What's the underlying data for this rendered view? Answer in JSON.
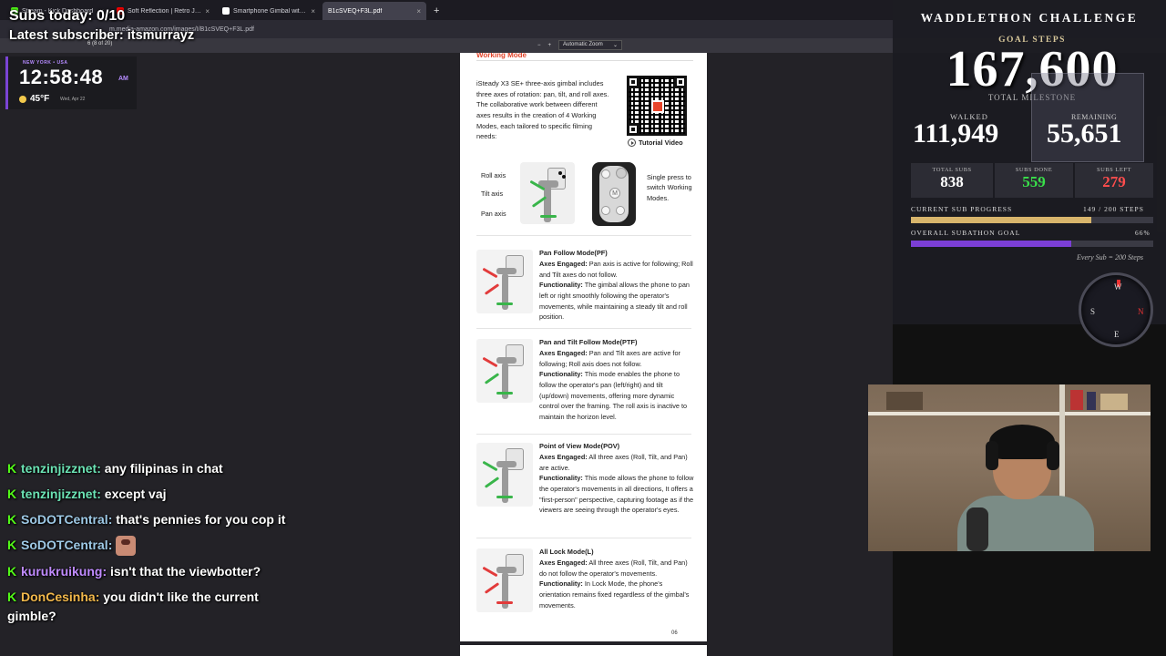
{
  "browser": {
    "tabs": [
      {
        "title": "Stream - Kick Dashboard",
        "color": "#53fc18"
      },
      {
        "title": "Soft Reflection | Retro Jazz - YouTube",
        "color": "#ff0000"
      },
      {
        "title": "Smartphone Gimbal with Phone",
        "color": "#ffffff"
      },
      {
        "title": "B1cSVEQ+F3L.pdf",
        "color": "#cccccc"
      }
    ],
    "active_tab_index": 3,
    "new_tab": "+",
    "close": "×",
    "url": "m.media-amazon.com/images/I/B1cSVEQ+F3L.pdf",
    "page_indicator": "6  (8 of 20)",
    "zoom_minus": "−",
    "zoom_plus": "+",
    "zoom_label": "Automatic Zoom",
    "zoom_arrow": "⌄"
  },
  "overlay": {
    "subs_today": "Subs today: 0/10",
    "latest_subscriber": "Latest subscriber: itsmurrayz",
    "clock_location": "NEW YORK • USA",
    "clock_time": "12:58:48",
    "clock_ampm": "AM",
    "temperature": "45°F",
    "date": "Wed, Apr 22"
  },
  "chat": [
    {
      "user": "tenzinjizznet",
      "color": "#6be3b4",
      "text": "any filipinas in chat"
    },
    {
      "user": "tenzinjizznet",
      "color": "#6be3b4",
      "text": "except vaj"
    },
    {
      "user": "SoDOTCentral",
      "color": "#9ec9e6",
      "text": "that's pennies for you cop it"
    },
    {
      "user": "SoDOTCentral",
      "color": "#9ec9e6",
      "text": "",
      "emote": "face-emote"
    },
    {
      "user": "kurukruikung",
      "color": "#c08bff",
      "text": "isn't that the viewbotter?"
    },
    {
      "user": "DonCesinha",
      "color": "#f2b84b",
      "text": "you didn't like the current gimble?"
    }
  ],
  "chat_badge": "K",
  "chat_sep": ":",
  "pdf": {
    "section_title": "Working Mode",
    "intro": "iSteady X3 SE+ three-axis gimbal includes three axes of rotation: pan, tilt, and roll axes. The collaborative work between different axes results in the creation of 4 Working Modes, each tailored to specific filming needs:",
    "tutorial": "Tutorial Video",
    "axis_labels": [
      "Roll axis",
      "Tilt axis",
      "Pan axis"
    ],
    "remote_letter": "M",
    "single_press": "Single press to switch Working Modes.",
    "axes_label": "Axes Engaged:",
    "func_label": "Functionality:",
    "modes": [
      {
        "name": "Pan Follow Mode(PF)",
        "axes": "Pan axis is active for following; Roll and Tilt axes do not follow.",
        "func": "The gimbal allows the phone to pan left or right smoothly following the operator's movements, while maintaining a steady tilt and roll position."
      },
      {
        "name": "Pan and Tilt Follow Mode(PTF)",
        "axes": "Pan and Tilt axes are active for following; Roll axis does not follow.",
        "func": "This mode enables the phone to follow the operator's pan (left/right) and tilt (up/down) movements, offering more dynamic control over the framing. The roll axis is inactive to maintain the horizon level."
      },
      {
        "name": "Point of View Mode(POV)",
        "axes": "All three axes (Roll, Tilt, and Pan) are active.",
        "func": "This mode allows the phone to follow the operator's movements in all directions, It offers a \"first-person\" perspective, capturing footage as if the viewers are seeing through the operator's eyes."
      },
      {
        "name": "All Lock Mode(L)",
        "axes": "All three axes (Roll, Tilt, and Pan) do not follow the operator's movements.",
        "func": "In Lock Mode, the phone's orientation remains fixed regardless of the gimbal's movements."
      }
    ],
    "page_number": "06"
  },
  "subathon": {
    "title": "WADDLETHON CHALLENGE",
    "goal_steps_label": "GOAL STEPS",
    "goal_steps": "167,600",
    "total_milestone": "TOTAL MILESTONE",
    "walked_label": "WALKED",
    "walked": "111,949",
    "remaining_label": "REMAINING",
    "remaining": "55,651",
    "total_subs_label": "TOTAL SUBS",
    "total_subs": "838",
    "subs_done_label": "SUBS DONE",
    "subs_done": "559",
    "subs_left_label": "SUBS LEFT",
    "subs_left": "279",
    "current_progress_label": "CURRENT SUB PROGRESS",
    "current_progress_text": "149 / 200 STEPS",
    "current_progress_fraction": 0.745,
    "overall_label": "OVERALL SUBATHON GOAL",
    "overall_text": "66%",
    "overall_fraction": 0.66,
    "every_sub": "Every Sub = 200 Steps",
    "compass": {
      "n": "W",
      "e": "N",
      "s": "E",
      "w": "S"
    },
    "colors": {
      "subs_done": "#39e04a",
      "subs_left": "#ff4d4d",
      "current_bar": "#d8b56c",
      "overall_bar": "#7c3fd6"
    }
  }
}
